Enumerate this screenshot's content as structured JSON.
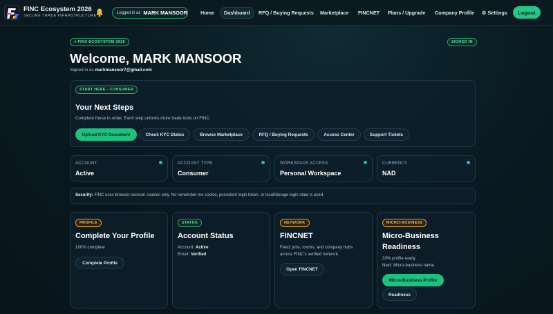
{
  "header": {
    "brand_name": "FINC Ecosystem 2026",
    "brand_tagline": "SECURE TRADE INFRASTRUCTURE",
    "logged_in_prefix": "Logged in as",
    "logged_in_user": "MARK MANSOOR",
    "nav": [
      "Home",
      "Dashboard",
      "RFQ / Buying Requests",
      "Marketplace",
      "FINCNET",
      "Plans / Upgrade",
      "Company Profile",
      "⚙ Settings"
    ],
    "active_nav": "Dashboard",
    "logout_label": "Logout"
  },
  "hero": {
    "eyebrow": "● FINC ECOSYSTEM 2026",
    "status_pill": "SIGNED IN",
    "title": "Welcome, MARK MANSOOR",
    "signed_in_prefix": "Signed in as",
    "email": "markmansoor7@gmail.com"
  },
  "next_steps": {
    "badge": "START HERE - CONSUMER",
    "title": "Your Next Steps",
    "description": "Complete these in order. Each step unlocks more trade tools on FINC.",
    "actions": [
      "Upload KYC Document",
      "Check KYC Status",
      "Browse Marketplace",
      "RFQ / Buying Requests",
      "Access Center",
      "Support Tickets"
    ]
  },
  "stats": [
    {
      "label": "ACCOUNT",
      "value": "Active",
      "dot_color": "#22c785"
    },
    {
      "label": "ACCOUNT TYPE",
      "value": "Consumer",
      "dot_color": "#22c785"
    },
    {
      "label": "WORKSPACE ACCESS",
      "value": "Personal Workspace",
      "dot_color": "#22c785"
    },
    {
      "label": "CURRENCY",
      "value": "NAD",
      "dot_color": "#35a7f0"
    }
  ],
  "security": {
    "label": "Security:",
    "text": "FINC uses browser-session cookies only. No remember-me cookie, persistent login token, or localStorage login state is used."
  },
  "cards": {
    "profile": {
      "badge": "PROFILE",
      "title": "Complete Your Profile",
      "text": "100% complete",
      "button": "Complete Profile"
    },
    "status": {
      "badge": "STATUS",
      "title": "Account Status",
      "account_label": "Account:",
      "account_value": "Active",
      "email_label": "Email:",
      "email_value": "Verified"
    },
    "network": {
      "badge": "NETWORK",
      "title": "FINCNET",
      "text_line1": "Feed, jobs, rooms, and company hubs",
      "text_line2": "across FINC's verified network.",
      "button": "Open FINCNET"
    },
    "micro": {
      "badge": "MICRO-BUSINESS",
      "title_line1": "Micro-Business",
      "title_line2": "Readiness",
      "text_line1": "33% profile ready",
      "text_line2": "Next: Micro-business name",
      "button_primary": "Micro-Business Profile",
      "button_secondary": "Readiness"
    }
  },
  "colors": {
    "accent": "#1ec07f",
    "warning": "#e3a334",
    "info": "#35a7f0"
  }
}
